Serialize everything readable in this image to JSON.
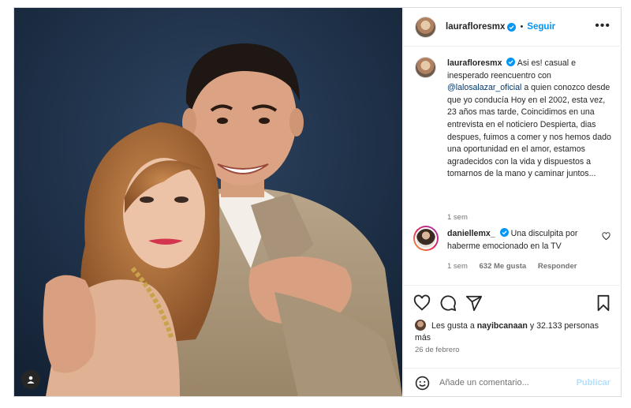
{
  "post": {
    "username": "laurafloresmx",
    "follow_label": "Seguir",
    "more_label": "•••",
    "dot_separator": "•"
  },
  "caption": {
    "username": "laurafloresmx",
    "text_before_mention": "Asi es! casual e inesperado reencuentro con",
    "mention": "@lalosalazar_oficial",
    "text_after_mention": "a quien conozco desde que yo conducía Hoy en el 2002, esta vez, 23 años mas tarde, Coincidimos en una entrevista en el noticiero Despierta, dias despues, fuimos a comer y nos hemos dado una oportunidad en el amor, estamos agradecidos con la vida y dispuestos a tomarnos de la mano y caminar juntos...",
    "time": "1 sem"
  },
  "comment": {
    "username": "daniellemx_",
    "text": "Una disculpita por haberme emocionado en la TV",
    "time": "1 sem",
    "likes": "632 Me gusta",
    "reply_label": "Responder"
  },
  "likes": {
    "prefix": "Les gusta a",
    "user": "nayibcanaan",
    "suffix": "y 32.133 personas más"
  },
  "date": "26 de febrero",
  "add_comment": {
    "placeholder": "Añade un comentario...",
    "publish_label": "Publicar"
  },
  "icons": {
    "like": "heart-icon",
    "comment": "comment-bubble-icon",
    "share": "paper-plane-icon",
    "save": "bookmark-icon",
    "emoji": "smiley-icon",
    "tags": "user-tag-icon",
    "verified": "verified-badge-icon",
    "more": "more-horizontal-icon"
  },
  "colors": {
    "accent": "#0095f6",
    "verified": "#0095f6",
    "text": "#262626",
    "muted": "#737373",
    "publish_disabled": "#b2dffc",
    "mention": "#00376b"
  }
}
